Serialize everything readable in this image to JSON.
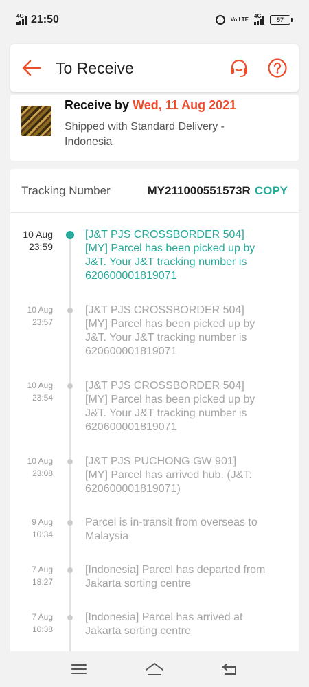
{
  "status_bar": {
    "network_left": "4G",
    "time": "21:50",
    "volte": "Vo LTE",
    "network_right": "4G",
    "battery": "57"
  },
  "header": {
    "title": "To Receive"
  },
  "delivery": {
    "receive_prefix": "Receive by",
    "receive_date": "Wed, 11 Aug 2021",
    "shipping_method": "Shipped with Standard Delivery - Indonesia"
  },
  "tracking": {
    "label": "Tracking Number",
    "number": "MY211000551573R",
    "copy_label": "COPY",
    "events": [
      {
        "date": "10 Aug",
        "time": "23:59",
        "lines": [
          "[J&T PJS CROSSBORDER 504]",
          "[MY] Parcel has been picked up by",
          "J&T. Your J&T tracking number is",
          "620600001819071"
        ]
      },
      {
        "date": "10 Aug",
        "time": "23:57",
        "lines": [
          "[J&T PJS CROSSBORDER 504]",
          "[MY] Parcel has been picked up by",
          "J&T. Your J&T tracking number is",
          "620600001819071"
        ]
      },
      {
        "date": "10 Aug",
        "time": "23:54",
        "lines": [
          "[J&T PJS CROSSBORDER 504]",
          "[MY] Parcel has been picked up by",
          "J&T. Your J&T tracking number is",
          "620600001819071"
        ]
      },
      {
        "date": "10 Aug",
        "time": "23:08",
        "lines": [
          "[J&T PJS PUCHONG GW 901]",
          "[MY] Parcel has arrived hub. (J&T:",
          "620600001819071)"
        ]
      },
      {
        "date": "9 Aug",
        "time": "10:34",
        "lines": [
          "Parcel is in-transit from overseas to",
          "Malaysia"
        ]
      },
      {
        "date": "7 Aug",
        "time": "18:27",
        "lines": [
          "[Indonesia] Parcel has departed from",
          "Jakarta sorting centre"
        ]
      },
      {
        "date": "7 Aug",
        "time": "10:38",
        "lines": [
          "[Indonesia] Parcel has arrived at",
          "Jakarta sorting centre"
        ]
      }
    ]
  },
  "colors": {
    "brand": "#ee4d2d",
    "accent": "#26aa99",
    "muted_text": "#a5a5a5"
  },
  "icons": {
    "back": "arrow-left-icon",
    "support": "headset-icon",
    "help": "question-circle-icon",
    "nav_menu": "menu-icon",
    "nav_home": "home-icon",
    "nav_back": "back-icon"
  }
}
